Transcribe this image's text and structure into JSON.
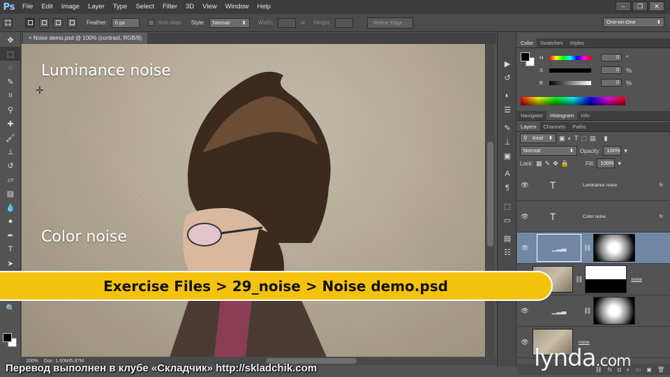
{
  "app": {
    "logo": "Ps",
    "menus": [
      "File",
      "Edit",
      "Image",
      "Layer",
      "Type",
      "Select",
      "Filter",
      "3D",
      "View",
      "Window",
      "Help"
    ],
    "window_controls": [
      "–",
      "❐",
      "✕"
    ]
  },
  "options_bar": {
    "feather_label": "Feather:",
    "feather_value": "0 px",
    "antialias_label": "Anti-alias",
    "style_label": "Style:",
    "style_value": "Normal",
    "width_label": "Width:",
    "height_label": "Height:",
    "refine_edge": "Refine Edge...",
    "workspace": "One-on-One"
  },
  "document": {
    "tab_title": "Noise demo.psd @ 100% (contrast, RGB/8)",
    "canvas_label_1": "Luminance noise",
    "canvas_label_2": "Color noise",
    "zoom": "100%",
    "doc_info": "Doc: 1.60M/5.87M"
  },
  "color_panel": {
    "tabs": [
      "Color",
      "Swatches",
      "Styles"
    ],
    "h_label": "H",
    "s_label": "S",
    "b_label": "B",
    "h_value": "0",
    "s_value": "0",
    "b_value": "0",
    "h_unit": "°",
    "s_unit": "%",
    "b_unit": "%"
  },
  "nav_panel": {
    "tabs": [
      "Navigator",
      "Histogram",
      "Info"
    ]
  },
  "layers_panel": {
    "tabs": [
      "Layers",
      "Channels",
      "Paths"
    ],
    "kind_filter": "Kind",
    "blend_mode": "Normal",
    "opacity_label": "Opacity:",
    "opacity_value": "100%",
    "lock_label": "Lock:",
    "fill_label": "Fill:",
    "fill_value": "100%",
    "layers": [
      {
        "name": "Luminance noise",
        "type": "text",
        "fx": "fx"
      },
      {
        "name": "Color noise",
        "type": "text",
        "fx": "fx"
      },
      {
        "name": "",
        "type": "adjustment",
        "selected": true
      },
      {
        "name": "noise",
        "type": "photo-mask"
      },
      {
        "name": "",
        "type": "adjustment"
      },
      {
        "name": "noise",
        "type": "photo"
      }
    ]
  },
  "overlay": {
    "banner_text": "Exercise Files > 29_noise > Noise demo.psd",
    "watermark": "Перевод выполнен в клубе «Складчик» http://skladchik.com",
    "brand": "lynda",
    "brand_suffix": ".com"
  },
  "colors": {
    "banner": "#f4c20d",
    "selected_layer": "#7187a6",
    "ps_logo": "#8ec9ff"
  }
}
